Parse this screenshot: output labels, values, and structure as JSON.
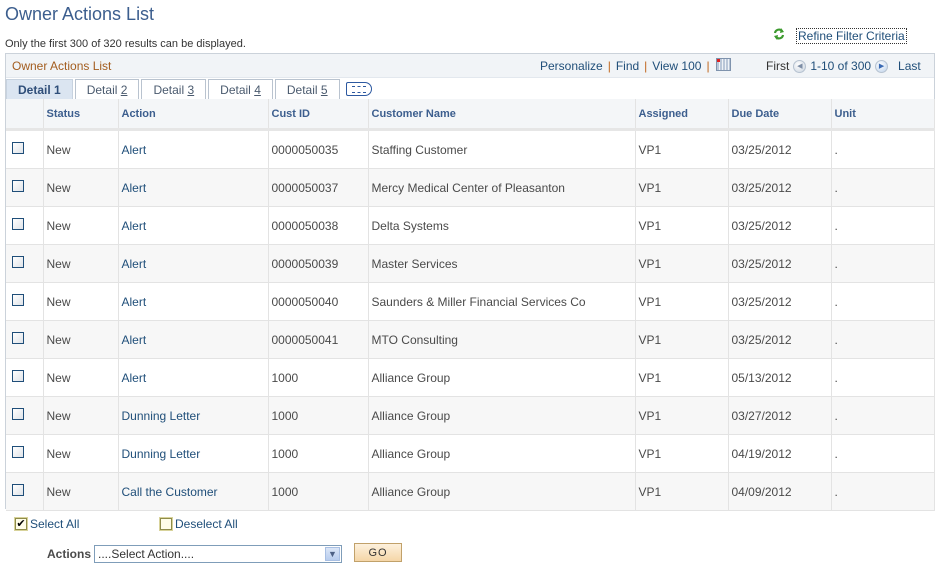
{
  "page": {
    "title": "Owner Actions List",
    "notice": "Only the first 300 of 320 results can be displayed.",
    "refine_link": "Refine Filter Criteria"
  },
  "grid": {
    "title": "Owner Actions List",
    "nav": {
      "personalize": "Personalize",
      "find": "Find",
      "view_all": "View 100",
      "separator": "|"
    },
    "pager": {
      "first": "First",
      "range": "1-10 of 300",
      "last": "Last"
    },
    "tabs": [
      {
        "prefix": "Detail ",
        "key": "1",
        "active": true
      },
      {
        "prefix": "Detail ",
        "key": "2",
        "active": false
      },
      {
        "prefix": "Detail ",
        "key": "3",
        "active": false
      },
      {
        "prefix": "Detail ",
        "key": "4",
        "active": false
      },
      {
        "prefix": "Detail ",
        "key": "5",
        "active": false
      }
    ],
    "columns": [
      "",
      "Status",
      "Action",
      "Cust ID",
      "Customer Name",
      "Assigned",
      "Due Date",
      "Unit"
    ],
    "rows": [
      {
        "status": "New",
        "action": "Alert",
        "cust_id": "0000050035",
        "customer": "Staffing Customer",
        "assigned": "VP1",
        "due": "03/25/2012",
        "unit": "."
      },
      {
        "status": "New",
        "action": "Alert",
        "cust_id": "0000050037",
        "customer": "Mercy Medical Center of Pleasanton",
        "assigned": "VP1",
        "due": "03/25/2012",
        "unit": "."
      },
      {
        "status": "New",
        "action": "Alert",
        "cust_id": "0000050038",
        "customer": "Delta Systems",
        "assigned": "VP1",
        "due": "03/25/2012",
        "unit": "."
      },
      {
        "status": "New",
        "action": "Alert",
        "cust_id": "0000050039",
        "customer": "Master Services",
        "assigned": "VP1",
        "due": "03/25/2012",
        "unit": "."
      },
      {
        "status": "New",
        "action": "Alert",
        "cust_id": "0000050040",
        "customer": "Saunders & Miller Financial Services Co",
        "assigned": "VP1",
        "due": "03/25/2012",
        "unit": "."
      },
      {
        "status": "New",
        "action": "Alert",
        "cust_id": "0000050041",
        "customer": "MTO Consulting",
        "assigned": "VP1",
        "due": "03/25/2012",
        "unit": "."
      },
      {
        "status": "New",
        "action": "Alert",
        "cust_id": "1000",
        "customer": "Alliance Group",
        "assigned": "VP1",
        "due": "05/13/2012",
        "unit": "."
      },
      {
        "status": "New",
        "action": "Dunning Letter",
        "cust_id": "1000",
        "customer": "Alliance Group",
        "assigned": "VP1",
        "due": "03/27/2012",
        "unit": "."
      },
      {
        "status": "New",
        "action": "Dunning Letter",
        "cust_id": "1000",
        "customer": "Alliance Group",
        "assigned": "VP1",
        "due": "04/19/2012",
        "unit": "."
      },
      {
        "status": "New",
        "action": "Call the Customer",
        "cust_id": "1000",
        "customer": "Alliance Group",
        "assigned": "VP1",
        "due": "04/09/2012",
        "unit": "."
      }
    ]
  },
  "footer": {
    "select_all": "Select All",
    "deselect_all": "Deselect All",
    "actions_label": "Actions",
    "actions_selected": "....Select Action....",
    "go_label": "GO"
  },
  "colors": {
    "title": "#3c5e8e",
    "link": "#1f4e79",
    "grid_title": "#a35d1f",
    "alt_row": "#f7f7f7"
  }
}
